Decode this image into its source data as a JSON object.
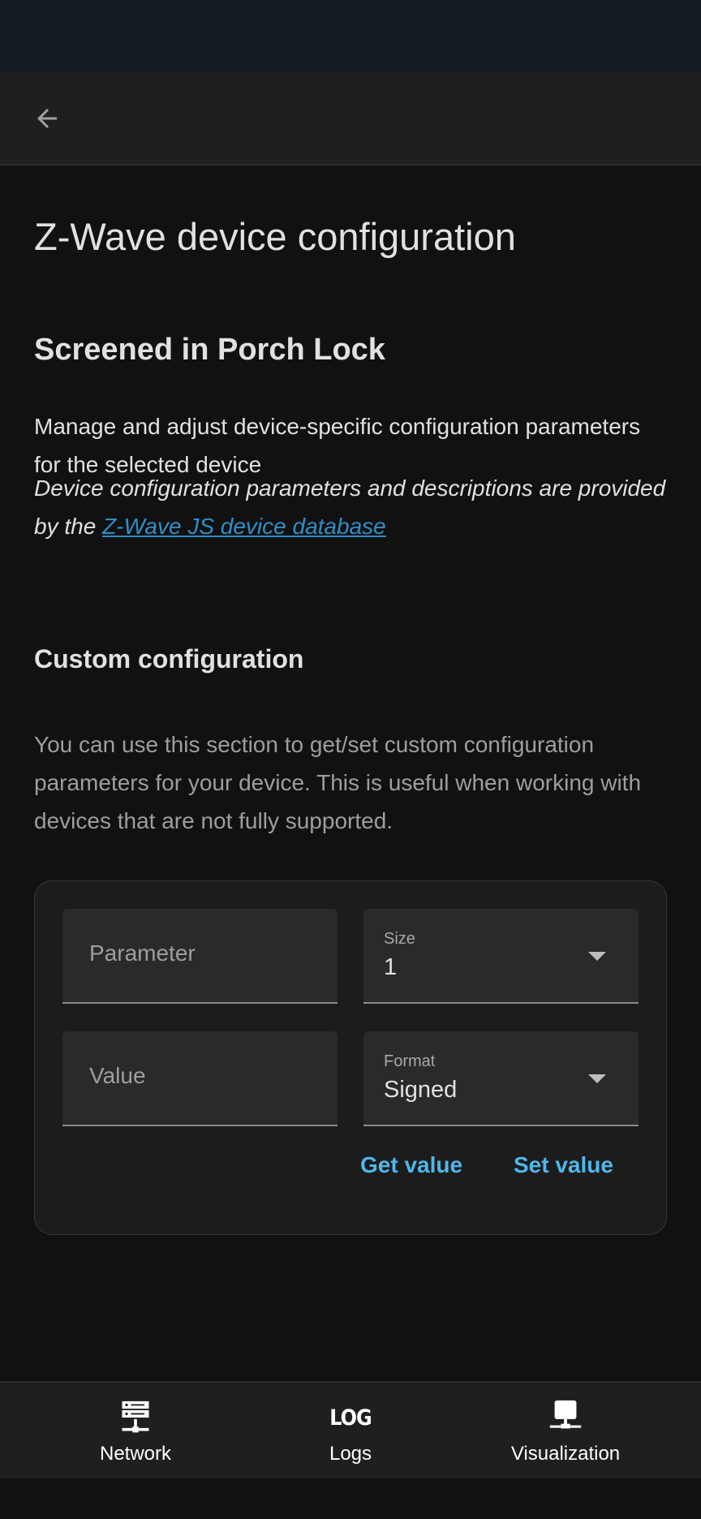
{
  "colors": {
    "background": "#111111",
    "app_bar": "#1f1f1f",
    "status_bar": "#141b21",
    "link": "#2f8ec7",
    "accent": "#4fb7ea"
  },
  "header": {
    "back_icon": "arrow-left-icon"
  },
  "page": {
    "title": "Z-Wave device configuration",
    "device_name": "Screened in Porch Lock",
    "description": "Manage and adjust device-specific configuration parameters for the selected device",
    "attribution_prefix": "Device configuration parameters and descriptions are provided by the ",
    "attribution_link": "Z-Wave JS device database"
  },
  "custom": {
    "title": "Custom configuration",
    "description": "You can use this section to get/set custom configuration parameters for your device. This is useful when working with devices that are not fully supported.",
    "parameter_placeholder": "Parameter",
    "value_placeholder": "Value",
    "size_label": "Size",
    "size_value": "1",
    "format_label": "Format",
    "format_value": "Signed",
    "get_button": "Get value",
    "set_button": "Set value"
  },
  "bottom_nav": {
    "items": [
      {
        "label": "Network",
        "icon": "server-network-icon"
      },
      {
        "label": "Logs",
        "icon": "log-icon",
        "icon_text": "LOG"
      },
      {
        "label": "Visualization",
        "icon": "monitor-network-icon"
      }
    ]
  }
}
